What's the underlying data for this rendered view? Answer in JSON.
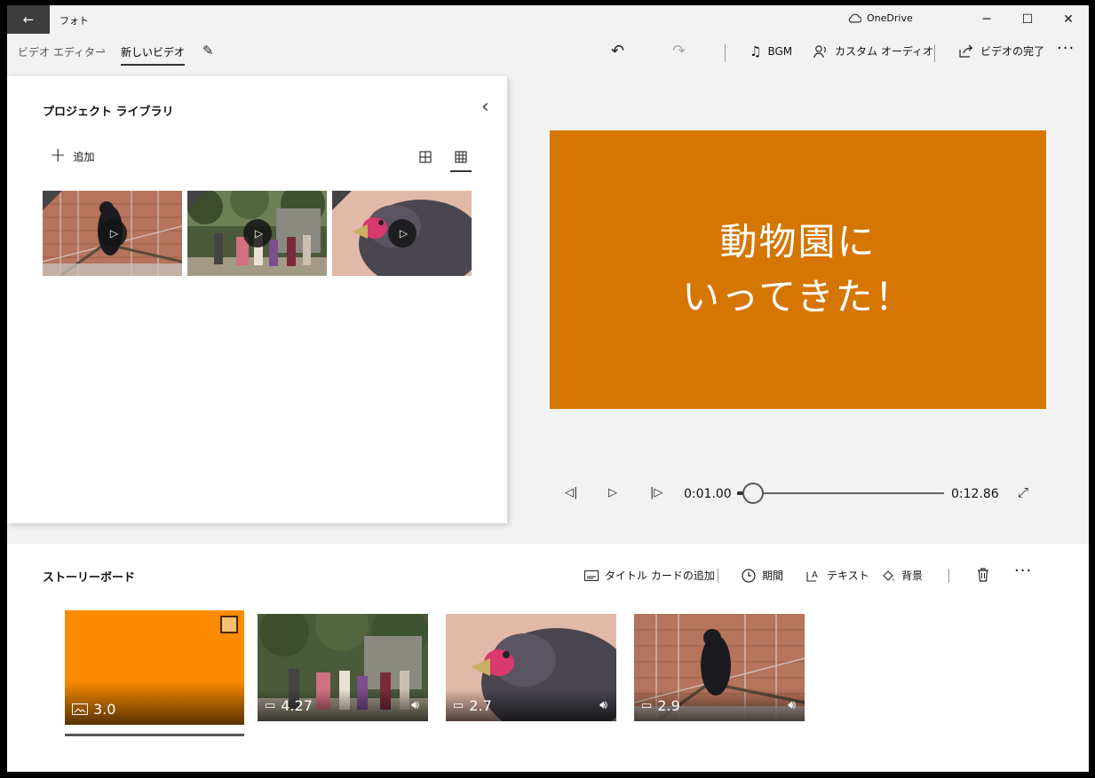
{
  "titlebar": {
    "app_title": "フォト",
    "onedrive_label": "OneDrive",
    "back_icon": "←",
    "minimize_icon": "─",
    "maximize_icon": "☐",
    "close_icon": "✕"
  },
  "breadcrumb": {
    "parent": "ビデオ エディター",
    "separator": "›",
    "current": "新しいビデオ"
  },
  "toolbar": {
    "bgm_label": "BGM",
    "custom_audio_label": "カスタム オーディオ",
    "finish_video_label": "ビデオの完了",
    "more": "···"
  },
  "library": {
    "title": "プロジェクト ライブラリ",
    "add_label": "追加",
    "items": [
      {
        "kind": "video",
        "subject": "bird in cage"
      },
      {
        "kind": "video",
        "subject": "zoo visitors"
      },
      {
        "kind": "video",
        "subject": "bird close-up"
      }
    ]
  },
  "preview": {
    "title_text": "動物園に\nいってきた！",
    "background_color": "#d57602"
  },
  "playback": {
    "current_time": "0:01.00",
    "total_time": "0:12.86",
    "progress": 0.078
  },
  "storyboard": {
    "title": "ストーリーボード",
    "add_title_card_label": "タイトル カードの追加",
    "duration_label": "期間",
    "text_label": "テキスト",
    "background_label": "背景",
    "more": "···",
    "clips": [
      {
        "type": "title-card",
        "duration": "3.0",
        "color": "#fb8c00",
        "selected": true
      },
      {
        "type": "video",
        "duration": "4.27",
        "audio": true
      },
      {
        "type": "video",
        "duration": "2.7",
        "audio": true
      },
      {
        "type": "video",
        "duration": "2.9",
        "audio": true
      }
    ]
  }
}
